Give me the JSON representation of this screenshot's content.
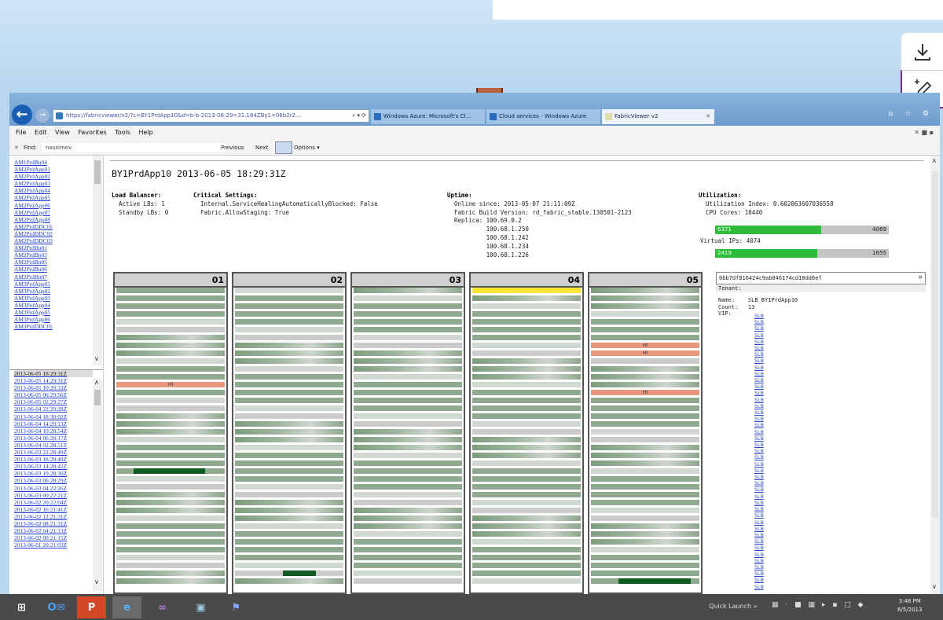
{
  "browser": {
    "address_url": "https://fabricviewer/v2/?c=BY1PrdApp10&d=b-b-2013-06-29=31.184ZBy1=06b2r2...",
    "address_controls": "⌕ ▾ ⟳",
    "tabs": [
      {
        "label": "Windows Azure: Microsoft's Cl...",
        "active": false
      },
      {
        "label": "Cloud services - Windows Azure",
        "active": false
      },
      {
        "label": "FabricViewer v2",
        "active": true
      }
    ],
    "window_controls": "⌂ ☆ ⚙",
    "menu": [
      "File",
      "Edit",
      "View",
      "Favorites",
      "Tools",
      "Help"
    ],
    "menu_right": "✕ ■ ▪",
    "find": {
      "label": "Find:",
      "value": "nassimov",
      "close": "✕",
      "previous": "Previous",
      "next": "Next",
      "options": "Options ▾"
    }
  },
  "sidebar": {
    "clusters": [
      "AM1PrdBn04",
      "AM2PrdApp01",
      "AM2PrdApp02",
      "AM2PrdApp03",
      "AM2PrdApp04",
      "AM2PrdApp05",
      "AM2PrdApp06",
      "AM2PrdApp07",
      "AM2PrdApp08",
      "AM2PrdDDC01",
      "AM2PrdDDC02",
      "AM2PrdDDC03",
      "AM2PrdBn01",
      "AM2PrdBn02",
      "AM2PrdBn05",
      "AM2PrdBn06",
      "AM2PrdBn07",
      "AM3PrdApp01",
      "AM3PrdApp02",
      "AM3PrdApp03",
      "AM3PrdApp04",
      "AM3PrdApp05",
      "AM3PrdApp06",
      "AM3PrdDDC01"
    ],
    "snapshots": [
      "2013-06-05 18:29:31Z",
      "2013-06-05 14:29:31Z",
      "2013-06-05 10:29:33Z",
      "2013-06-05 06:29:56Z",
      "2013-06-05 02:29:27Z",
      "2013-06-04 22:29:28Z",
      "2013-06-04 18:30:02Z",
      "2013-06-04 14:29:13Z",
      "2013-06-04 10:28:54Z",
      "2013-06-04 06:29:17Z",
      "2013-06-04 02:28:51Z",
      "2013-06-03 22:28:49Z",
      "2013-06-03 18:28:49Z",
      "2013-06-03 14:28:42Z",
      "2013-06-03 10:28:30Z",
      "2013-06-03 06:28:29Z",
      "2013-06-03 04:22:26Z",
      "2013-06-03 00:22:21Z",
      "2013-06-02 20:22:04Z",
      "2013-06-02 16:21:41Z",
      "2013-06-02 12:21:31Z",
      "2013-06-02 08:21:31Z",
      "2013-06-02 04:21:13Z",
      "2013-06-02 00:21:15Z",
      "2013-06-01 20:21:03Z"
    ]
  },
  "page": {
    "title": "BY1PrdApp10  2013-06-05 18:29:31Z",
    "load_balancer": {
      "heading": "Load Balancer:",
      "active": "Active LBs: 1",
      "standby": "Standby LBs: 0"
    },
    "critical": {
      "heading": "Critical Settings:",
      "line1": "Internal.ServiceHealingAutomaticallyBlocked: False",
      "line2": "Fabric.AllowStaging: True"
    },
    "uptime": {
      "heading": "Uptime:",
      "online": "Online since: 2013-05-07 21:11:09Z",
      "build": "Fabric Build Version: rd_fabric_stable.130501-2123",
      "replica_label": "Replica:",
      "replicas": [
        "100.69.0.2",
        "100.68.1.250",
        "100.68.1.242",
        "100.68.1.234",
        "100.68.1.226"
      ]
    },
    "utilization": {
      "heading": "Utilization:",
      "index": "Utilization Index: 0.602063607036558",
      "cpu": "CPU Cores: 10440",
      "cpu_bar": {
        "label": "6371",
        "value": "4069",
        "fill": 0.61
      },
      "vip": "Virtual IPs: 4074",
      "vip_bar": {
        "label": "2419",
        "value": "1655",
        "fill": 0.59
      }
    },
    "racks": [
      {
        "id": "01",
        "marks": [
          {
            "row": 12,
            "type": "red",
            "text": "HI"
          },
          {
            "row": 23,
            "type": "dark",
            "start": 0.16,
            "end": 0.82
          }
        ]
      },
      {
        "id": "02",
        "marks": [
          {
            "row": 36,
            "type": "dark",
            "start": 0.44,
            "end": 0.75
          }
        ]
      },
      {
        "id": "03",
        "marks": []
      },
      {
        "id": "04",
        "marks": [
          {
            "row": 0,
            "type": "yellow",
            "text": ""
          }
        ]
      },
      {
        "id": "05",
        "marks": [
          {
            "row": 7,
            "type": "red",
            "text": "HI"
          },
          {
            "row": 8,
            "type": "red",
            "text": "HI"
          },
          {
            "row": 13,
            "type": "red",
            "text": "HI"
          },
          {
            "row": 37,
            "type": "dark",
            "start": 0.25,
            "end": 0.92
          }
        ]
      }
    ],
    "search_value": "0bb7df816424c9ab046174cd18dd6ef",
    "tenant_label": "Tenant:",
    "tenant": {
      "name": "Name:    SLB_BY1PrdApp10",
      "count": "Count:   13",
      "vip": "VIP:"
    },
    "vip_links": [
      "SLB",
      "SLB",
      "SLB",
      "SLB",
      "SLB",
      "SLB",
      "SLB",
      "SLB",
      "SLB",
      "SLB",
      "SLB",
      "SLB",
      "SLB",
      "SLB",
      "SLB",
      "SLB",
      "SLB",
      "SLB",
      "SLB",
      "SLB",
      "SLB",
      "SLB",
      "SLB",
      "SLB",
      "SLB",
      "SLB",
      "SLB",
      "SLB",
      "SLB",
      "SLB",
      "SLB",
      "SLB",
      "SLB",
      "SLB",
      "SLB",
      "SLB",
      "SLB",
      "SLB",
      "SLB",
      "SLB",
      "SLB",
      "SLB",
      "SLB"
    ]
  },
  "taskbar": {
    "apps": [
      "⊞",
      "O✉",
      "P",
      "e",
      "∞",
      "▣",
      "⚑"
    ],
    "quick_launch": "Quick Launch »",
    "tray": "▦ · ■ ▦ ▸ ▪ □ ◆",
    "time": "3:48 PM",
    "date": "6/5/2013"
  }
}
